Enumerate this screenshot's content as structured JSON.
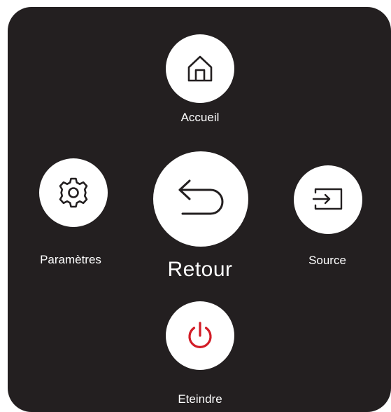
{
  "menu": {
    "home_label": "Accueil",
    "settings_label": "Paramètres",
    "back_label": "Retour",
    "source_label": "Source",
    "power_label": "Eteindre"
  },
  "colors": {
    "panel": "#231f20",
    "button": "#ffffff",
    "icon": "#231f20",
    "power_icon": "#d21c26",
    "text": "#ffffff"
  },
  "icons": {
    "home": "home-icon",
    "settings": "gear-icon",
    "back": "back-arrow-icon",
    "source": "source-input-icon",
    "power": "power-icon"
  },
  "selected_item": "back"
}
